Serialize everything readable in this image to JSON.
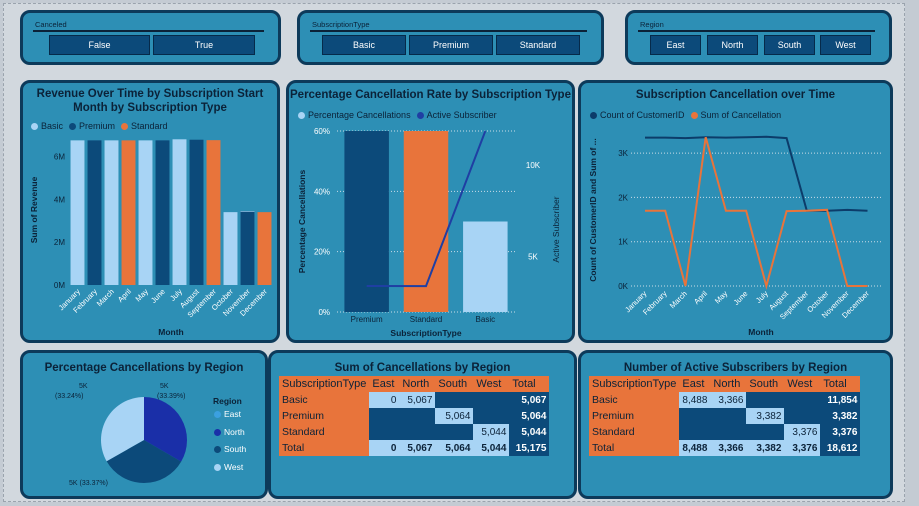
{
  "slicers": [
    {
      "title": "Canceled",
      "options": [
        "False",
        "True"
      ]
    },
    {
      "title": "SubscriptionType",
      "options": [
        "Basic",
        "Premium",
        "Standard"
      ]
    },
    {
      "title": "Region",
      "options": [
        "East",
        "North",
        "South",
        "West"
      ]
    }
  ],
  "revenue_chart": {
    "title_line1": "Revenue Over Time by Subscription Start",
    "title_line2": "Month by Subscription Type",
    "legend": [
      "Basic",
      "Premium",
      "Standard"
    ],
    "ylabel": "Sum of Revenue",
    "xlabel": "Month",
    "yticks": [
      "0M",
      "2M",
      "4M",
      "6M"
    ]
  },
  "rate_chart": {
    "title": "Percentage Cancellation Rate by Subscription Type",
    "legend": [
      "Percentage Cancellations",
      "Active Subscriber"
    ],
    "ylabel": "Percentage Cancellations",
    "y2label": "Active Subscriber",
    "xlabel": "SubscriptionType",
    "yticks": [
      "0%",
      "20%",
      "40%",
      "60%"
    ],
    "y2ticks": [
      "5K",
      "10K"
    ]
  },
  "time_chart": {
    "title": "Subscription Cancellation over Time",
    "legend": [
      "Count of CustomerID",
      "Sum of Cancellation"
    ],
    "ylabel": "Count of CustomerID and Sum of ...",
    "xlabel": "Month",
    "yticks": [
      "0K",
      "1K",
      "2K",
      "3K"
    ]
  },
  "pie_chart": {
    "title": "Percentage Cancellations by Region",
    "legend_title": "Region",
    "legend": [
      "East",
      "North",
      "South",
      "West"
    ],
    "labels": [
      "5K",
      "(33.24%)",
      "5K",
      "(33.39%)",
      "5K (33.37%)"
    ]
  },
  "cancel_table": {
    "title": "Sum of Cancellations by Region",
    "headers": [
      "SubscriptionType",
      "East",
      "North",
      "South",
      "West",
      "Total"
    ],
    "rows": [
      [
        "Basic",
        "0",
        "5,067",
        "",
        "",
        "5,067"
      ],
      [
        "Premium",
        "",
        "",
        "5,064",
        "",
        "5,064"
      ],
      [
        "Standard",
        "",
        "",
        "",
        "5,044",
        "5,044"
      ],
      [
        "Total",
        "0",
        "5,067",
        "5,064",
        "5,044",
        "15,175"
      ]
    ]
  },
  "active_table": {
    "title": "Number of Active Subscribers by Region",
    "headers": [
      "SubscriptionType",
      "East",
      "North",
      "South",
      "West",
      "Total"
    ],
    "rows": [
      [
        "Basic",
        "8,488",
        "3,366",
        "",
        "",
        "11,854"
      ],
      [
        "Premium",
        "",
        "",
        "3,382",
        "",
        "3,382"
      ],
      [
        "Standard",
        "",
        "",
        "",
        "3,376",
        "3,376"
      ],
      [
        "Total",
        "8,488",
        "3,366",
        "3,382",
        "3,376",
        "18,612"
      ]
    ]
  },
  "colors": {
    "basic": "#a8d4f5",
    "premium": "#0c4a7a",
    "standard": "#e8743b",
    "active_line": "#1f3fa3",
    "count_line": "#0c3c6a",
    "sum_line": "#e8743b",
    "east": "#3ba0e0",
    "north": "#1a2fa8",
    "south": "#0c4a7a",
    "west": "#a8d4f5"
  },
  "chart_data": [
    {
      "type": "bar",
      "title": "Revenue Over Time by Subscription Start Month by Subscription Type",
      "xlabel": "Month",
      "ylabel": "Sum of Revenue",
      "ylim": [
        0,
        7000000
      ],
      "categories": [
        "January",
        "February",
        "March",
        "April",
        "May",
        "June",
        "July",
        "August",
        "September",
        "October",
        "November",
        "December"
      ],
      "series": [
        {
          "name": "Basic",
          "values": [
            6750000,
            null,
            6750000,
            null,
            6750000,
            null,
            6800000,
            null,
            null,
            3400000,
            3450000,
            null
          ]
        },
        {
          "name": "Premium",
          "values": [
            null,
            6750000,
            null,
            null,
            null,
            6750000,
            null,
            6780000,
            null,
            null,
            3420000,
            null
          ]
        },
        {
          "name": "Standard",
          "values": [
            null,
            null,
            null,
            6750000,
            null,
            null,
            null,
            null,
            6760000,
            null,
            null,
            3400000
          ]
        }
      ]
    },
    {
      "type": "bar",
      "title": "Percentage Cancellation Rate by Subscription Type",
      "xlabel": "SubscriptionType",
      "ylabel": "Percentage Cancellations",
      "ylim": [
        0,
        0.6
      ],
      "categories": [
        "Premium",
        "Standard",
        "Basic"
      ],
      "series": [
        {
          "name": "Percentage Cancellations",
          "values": [
            0.6,
            0.6,
            0.3
          ]
        },
        {
          "name": "Active Subscriber",
          "axis": "secondary",
          "type": "line",
          "values": [
            3382,
            3376,
            11854
          ]
        }
      ]
    },
    {
      "type": "line",
      "title": "Subscription Cancellation over Time",
      "xlabel": "Month",
      "ylabel": "Count of CustomerID and Sum of ...",
      "ylim": [
        0,
        3500
      ],
      "categories": [
        "January",
        "February",
        "March",
        "April",
        "May",
        "June",
        "July",
        "August",
        "September",
        "October",
        "November",
        "December"
      ],
      "series": [
        {
          "name": "Count of CustomerID",
          "values": [
            3350,
            3350,
            3340,
            3360,
            3350,
            3360,
            3370,
            3340,
            1700,
            1700,
            1720,
            1700
          ]
        },
        {
          "name": "Sum of Cancellation",
          "values": [
            1700,
            1700,
            0,
            3360,
            1700,
            1700,
            0,
            1690,
            1700,
            1720,
            0,
            0
          ]
        }
      ]
    },
    {
      "type": "pie",
      "title": "Percentage Cancellations by Region",
      "categories": [
        "East",
        "North",
        "South",
        "West"
      ],
      "values": [
        0,
        5067,
        5064,
        5044
      ],
      "percentages": [
        0,
        33.39,
        33.37,
        33.24
      ]
    }
  ]
}
